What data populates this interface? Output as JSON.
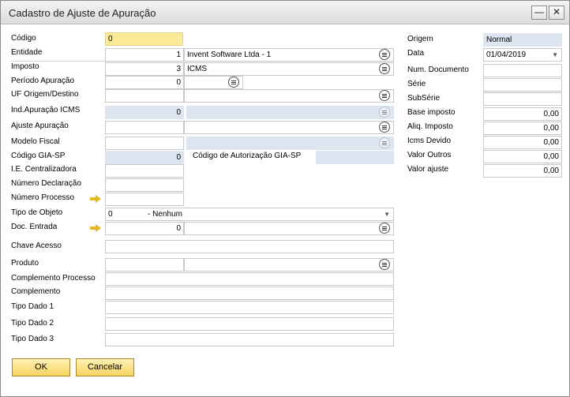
{
  "window": {
    "title": "Cadastro de Ajuste de Apuração",
    "minimize_icon": "minimize-icon",
    "close_icon": "close-icon"
  },
  "left": {
    "codigo": {
      "label": "Código",
      "value": "0"
    },
    "entidade": {
      "label": "Entidade",
      "value": "1",
      "desc": "Invent Software Ltda - 1"
    },
    "imposto": {
      "label": "Imposto",
      "value": "3",
      "desc": "ICMS"
    },
    "periodo": {
      "label": "Período Apuração",
      "value": "0",
      "desc": ""
    },
    "uf": {
      "label": "UF Origem/Destino",
      "value": "",
      "desc": ""
    },
    "ind_apuracao": {
      "label": "Ind.Apuração ICMS",
      "value": "0",
      "desc": ""
    },
    "ajuste": {
      "label": "Ajuste Apuração",
      "value": "",
      "desc": ""
    },
    "modelo": {
      "label": "Modelo Fiscal",
      "value": "",
      "desc": ""
    },
    "gia_sp": {
      "label": "Código GIA-SP",
      "value": "0",
      "autorizacao_label": "Código de Autorização GIA-SP",
      "autorizacao_value": ""
    },
    "ie_centralizadora": {
      "label": "I.E. Centralizadora",
      "value": ""
    },
    "num_declaracao": {
      "label": "Número Declaração",
      "value": ""
    },
    "num_processo": {
      "label": "Número Processo",
      "value": ""
    },
    "tipo_objeto": {
      "label": "Tipo de Objeto",
      "value": "0",
      "desc": "- Nenhum"
    },
    "doc_entrada": {
      "label": "Doc. Entrada",
      "value": "0",
      "desc": ""
    },
    "chave_acesso": {
      "label": "Chave Acesso",
      "value": ""
    },
    "produto": {
      "label": "Produto",
      "value": "",
      "desc": ""
    },
    "complemento_processo": {
      "label": "Complemento Processo",
      "value": ""
    },
    "complemento": {
      "label": "Complemento",
      "value": ""
    },
    "tipo_dado1": {
      "label": "Tipo Dado 1",
      "value": ""
    },
    "tipo_dado2": {
      "label": "Tipo Dado 2",
      "value": ""
    },
    "tipo_dado3": {
      "label": "Tipo Dado 3",
      "value": ""
    }
  },
  "right": {
    "origem": {
      "label": "Origem",
      "value": "Normal"
    },
    "data": {
      "label": "Data",
      "value": "01/04/2019"
    },
    "num_documento": {
      "label": "Num. Documento",
      "value": ""
    },
    "serie": {
      "label": "Série",
      "value": ""
    },
    "subserie": {
      "label": "SubSérie",
      "value": ""
    },
    "base_imposto": {
      "label": "Base imposto",
      "value": "0,00"
    },
    "aliq_imposto": {
      "label": "Aliq. Imposto",
      "value": "0,00"
    },
    "icms_devido": {
      "label": "Icms Devido",
      "value": "0,00"
    },
    "valor_outros": {
      "label": "Valor Outros",
      "value": "0,00"
    },
    "valor_ajuste": {
      "label": "Valor ajuste",
      "value": "0,00"
    }
  },
  "buttons": {
    "ok": "OK",
    "cancel": "Cancelar"
  },
  "colors": {
    "accent_yellow": "#fbeb98",
    "readonly_blue": "#dde6f0",
    "button_gold": "#f5d35c"
  }
}
